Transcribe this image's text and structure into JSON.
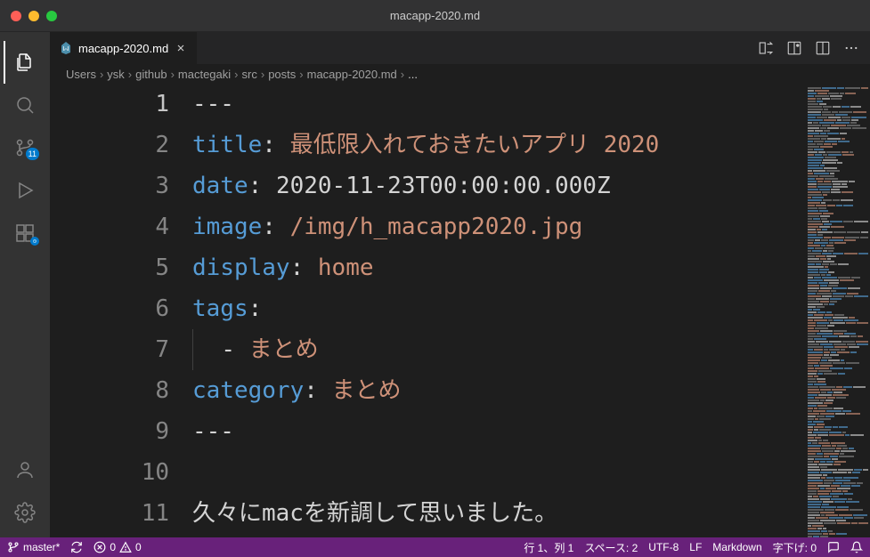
{
  "window": {
    "title": "macapp-2020.md"
  },
  "activityBar": {
    "sourceControlBadge": "11"
  },
  "tab": {
    "filename": "macapp-2020.md"
  },
  "breadcrumbs": {
    "items": [
      "Users",
      "ysk",
      "github",
      "mactegaki",
      "src",
      "posts",
      "macapp-2020.md",
      "..."
    ]
  },
  "code": {
    "lines": [
      {
        "num": "1",
        "tokens": [
          {
            "cls": "tk-dash",
            "t": "---"
          }
        ]
      },
      {
        "num": "2",
        "tokens": [
          {
            "cls": "tk-key",
            "t": "title"
          },
          {
            "cls": "tk-colon",
            "t": ": "
          },
          {
            "cls": "tk-str",
            "t": "最低限入れておきたいアプリ "
          },
          {
            "cls": "tk-num",
            "t": "2020"
          }
        ]
      },
      {
        "num": "3",
        "tokens": [
          {
            "cls": "tk-key",
            "t": "date"
          },
          {
            "cls": "tk-colon",
            "t": ": "
          },
          {
            "cls": "tk-date",
            "t": "2020-11-23T00:00:00.000Z"
          }
        ]
      },
      {
        "num": "4",
        "tokens": [
          {
            "cls": "tk-key",
            "t": "image"
          },
          {
            "cls": "tk-colon",
            "t": ": "
          },
          {
            "cls": "tk-str",
            "t": "/img/h_macapp2020.jpg"
          }
        ]
      },
      {
        "num": "5",
        "tokens": [
          {
            "cls": "tk-key",
            "t": "display"
          },
          {
            "cls": "tk-colon",
            "t": ": "
          },
          {
            "cls": "tk-str",
            "t": "home"
          }
        ]
      },
      {
        "num": "6",
        "tokens": [
          {
            "cls": "tk-key",
            "t": "tags"
          },
          {
            "cls": "tk-colon",
            "t": ":"
          }
        ]
      },
      {
        "num": "7",
        "tokens": [
          {
            "cls": "tk-text",
            "t": "  "
          },
          {
            "cls": "tk-dash",
            "t": "-"
          },
          {
            "cls": "tk-text",
            "t": " "
          },
          {
            "cls": "tk-str",
            "t": "まとめ"
          }
        ],
        "indentGuide": true
      },
      {
        "num": "8",
        "tokens": [
          {
            "cls": "tk-key",
            "t": "category"
          },
          {
            "cls": "tk-colon",
            "t": ": "
          },
          {
            "cls": "tk-str",
            "t": "まとめ"
          }
        ]
      },
      {
        "num": "9",
        "tokens": [
          {
            "cls": "tk-dash",
            "t": "---"
          }
        ]
      },
      {
        "num": "10",
        "tokens": []
      },
      {
        "num": "11",
        "tokens": [
          {
            "cls": "tk-text",
            "t": "久々にmacを新調して思いました。"
          }
        ]
      }
    ]
  },
  "statusbar": {
    "branch": "master*",
    "errors": "0",
    "warnings": "0",
    "cursor": "行 1、列 1",
    "spaces": "スペース: 2",
    "encoding": "UTF-8",
    "eol": "LF",
    "language": "Markdown",
    "indent": "字下げ: 0"
  }
}
